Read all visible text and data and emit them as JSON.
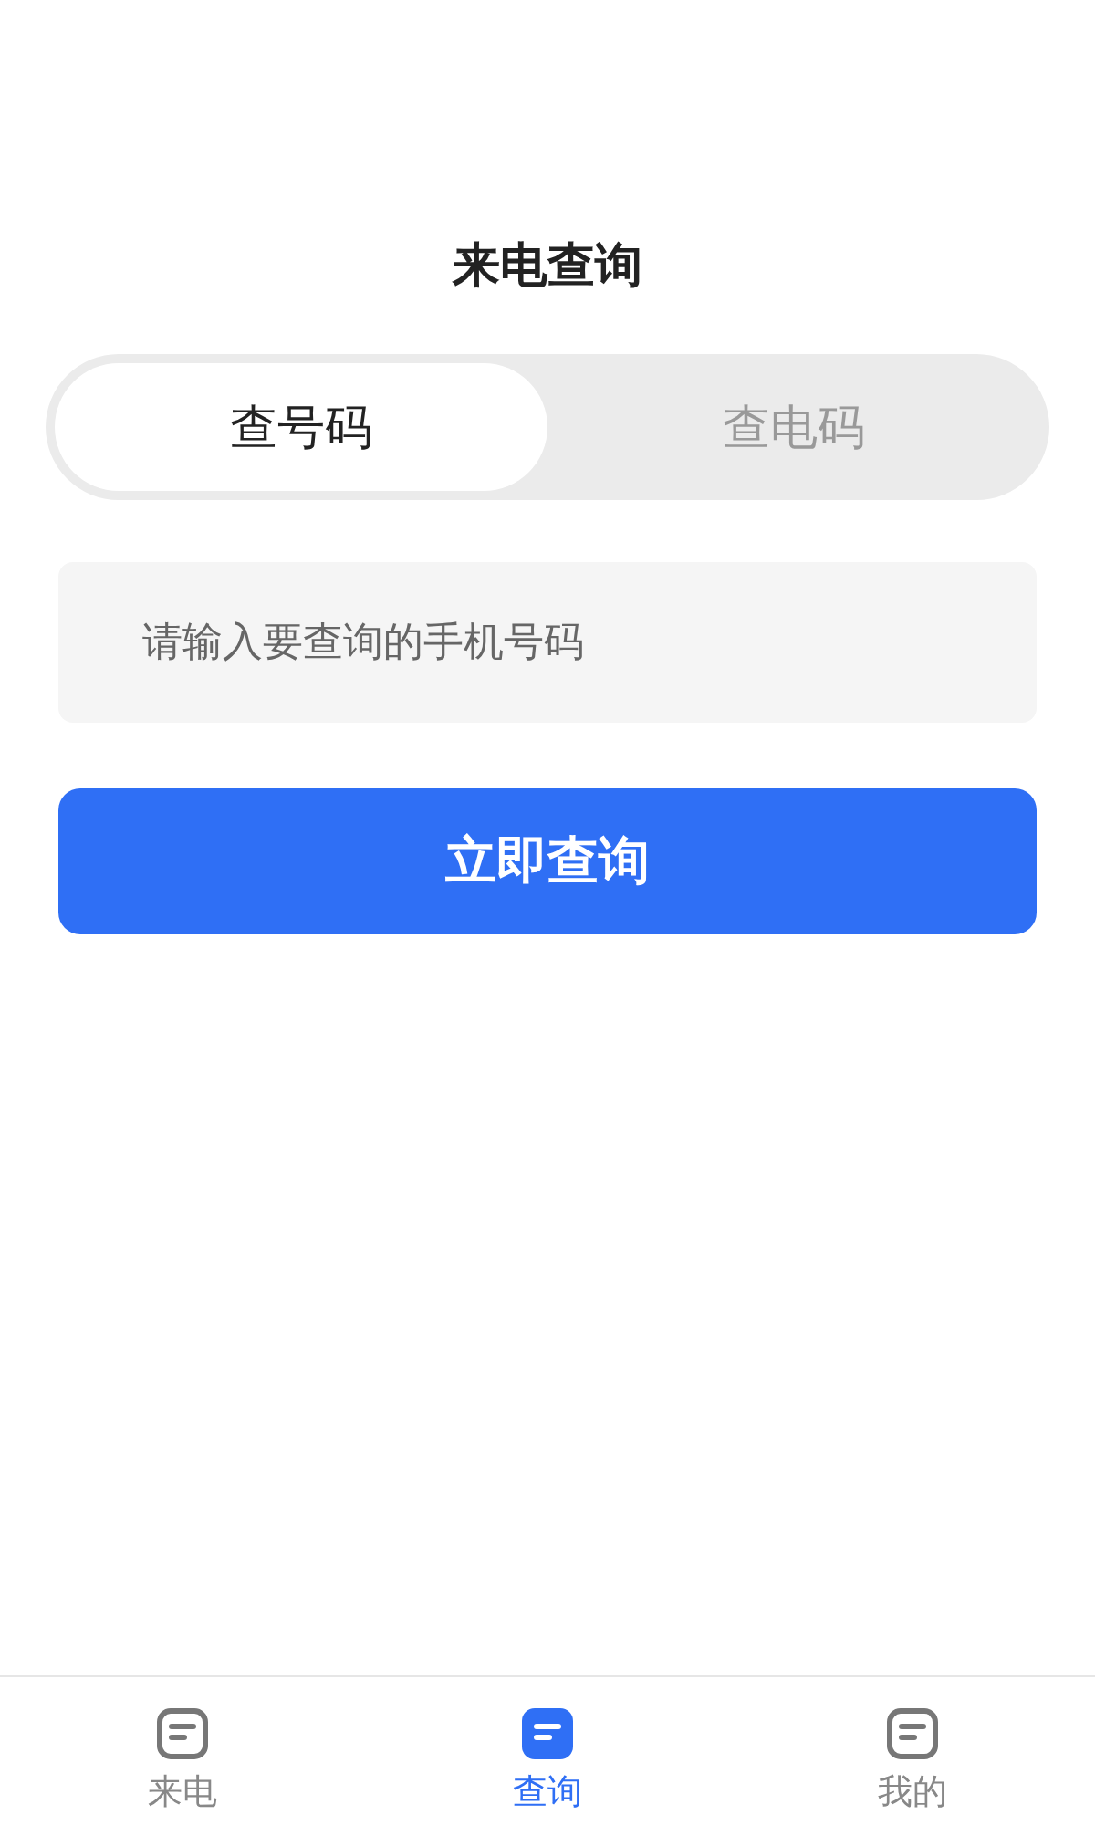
{
  "header": {
    "title": "来电查询"
  },
  "tabs": [
    {
      "label": "查号码",
      "selected": true
    },
    {
      "label": "查电码",
      "selected": false
    }
  ],
  "search": {
    "placeholder": "请输入要查询的手机号码"
  },
  "submit": {
    "label": "立即查询"
  },
  "nav": [
    {
      "label": "来电",
      "selected": false
    },
    {
      "label": "查询",
      "selected": true
    },
    {
      "label": "我的",
      "selected": false
    }
  ]
}
